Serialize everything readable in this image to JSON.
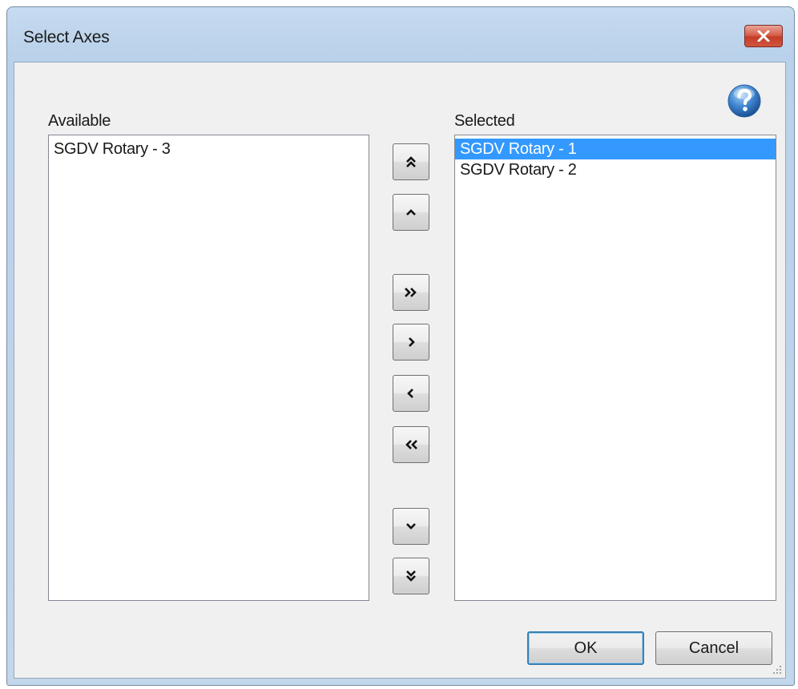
{
  "window": {
    "title": "Select Axes"
  },
  "available": {
    "label": "Available",
    "items": [
      "SGDV Rotary - 3"
    ]
  },
  "selected": {
    "label": "Selected",
    "items": [
      "SGDV Rotary - 1",
      "SGDV Rotary - 2"
    ],
    "highlighted_index": 0
  },
  "buttons": {
    "ok": "OK",
    "cancel": "Cancel"
  },
  "colors": {
    "selection": "#3399ff",
    "close_button": "#c33d27",
    "help_icon": "#3f86d0"
  },
  "icons": {
    "close": "close-icon",
    "help": "help-icon",
    "move_top": "double-chevron-up-icon",
    "move_up": "chevron-up-icon",
    "add_all": "double-chevron-right-icon",
    "add": "chevron-right-icon",
    "remove": "chevron-left-icon",
    "remove_all": "double-chevron-left-icon",
    "move_down": "chevron-down-icon",
    "move_bottom": "double-chevron-down-icon"
  }
}
